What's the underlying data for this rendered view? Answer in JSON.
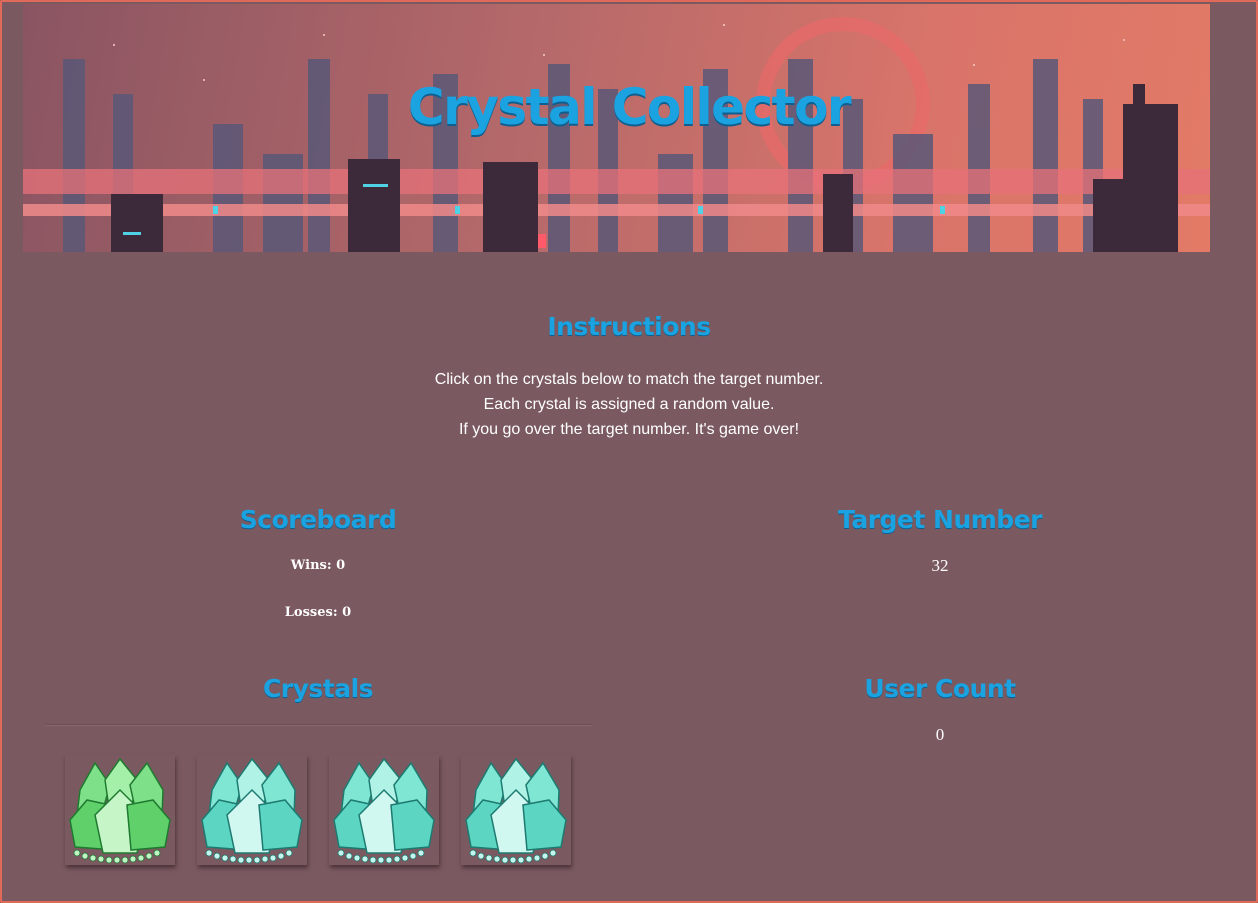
{
  "header": {
    "title": "Crystal Collector"
  },
  "instructions": {
    "heading": "Instructions",
    "lines": [
      "Click on the crystals below to match the target number.",
      "Each crystal is assigned a random value.",
      "If you go over the target number. It's game over!"
    ]
  },
  "scoreboard": {
    "heading": "Scoreboard",
    "wins": "Wins: 0",
    "losses": "Losses: 0"
  },
  "target": {
    "heading": "Target Number",
    "value": "32"
  },
  "crystals": {
    "heading": "Crystals",
    "items": [
      {
        "icon": "green-crystal-icon",
        "color": "#5fd86a"
      },
      {
        "icon": "teal-crystal-icon",
        "color": "#6fe0c8"
      },
      {
        "icon": "teal-crystal-icon",
        "color": "#6fe0c8"
      },
      {
        "icon": "teal-crystal-icon",
        "color": "#6fe0c8"
      }
    ]
  },
  "user_count": {
    "heading": "User Count",
    "value": "0"
  },
  "colors": {
    "background": "#7a5a60",
    "accent": "#1aa3e0",
    "border": "#e0695a"
  }
}
